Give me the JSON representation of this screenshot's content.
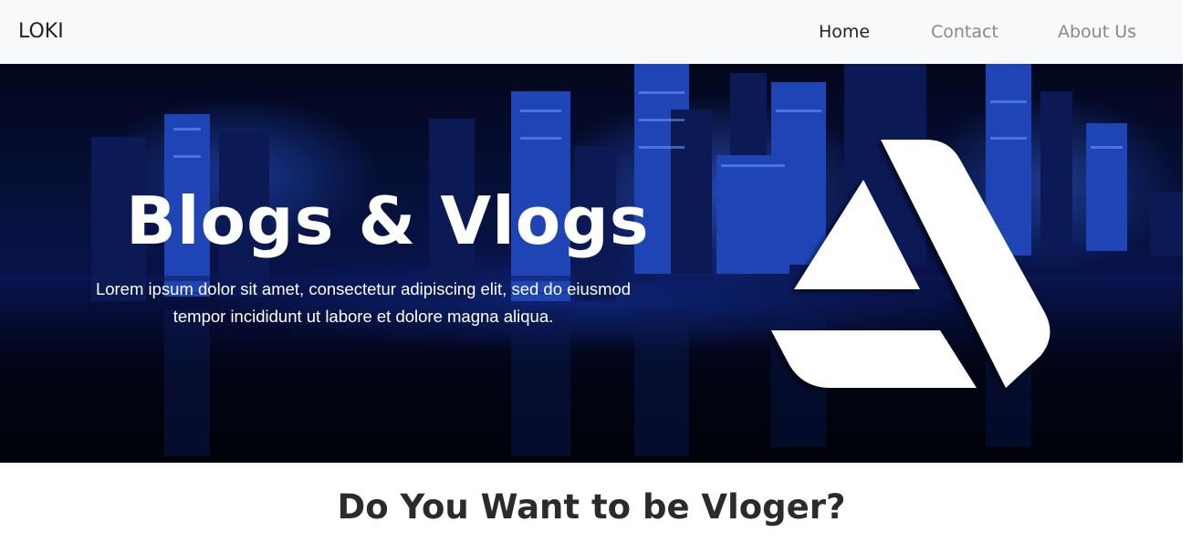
{
  "navbar": {
    "brand": "LOKI",
    "links": [
      {
        "label": "Home",
        "active": true
      },
      {
        "label": "Contact",
        "active": false
      },
      {
        "label": "About Us",
        "active": false
      }
    ]
  },
  "hero": {
    "title": "Blogs & Vlogs",
    "description_line1": "Lorem ipsum dolor sit amet, consectetur adipiscing elit, sed do eiusmod",
    "description_line2": "tempor incididunt ut labore et dolore magna aliqua.",
    "logo_icon": "delta-triangle-logo-icon"
  },
  "section": {
    "title": "Do You Want to be Vloger?"
  },
  "colors": {
    "navbar_bg": "#f8f9fa",
    "nav_active": "#222222",
    "nav_inactive": "#888888",
    "hero_text": "#ffffff",
    "heading": "#2b2b2b"
  }
}
